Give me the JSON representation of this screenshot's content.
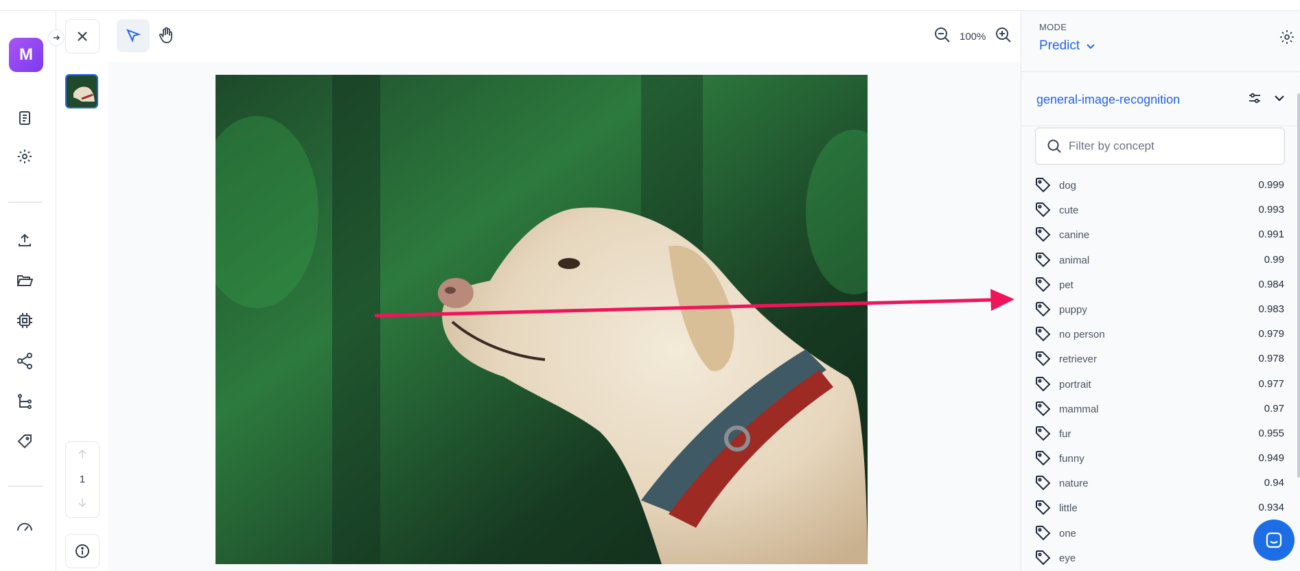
{
  "app": {
    "avatar_letter": "M",
    "accent": "#2563eb",
    "avatar_color": "#8b5cf6"
  },
  "toolbar": {
    "zoom": "100%"
  },
  "pager": {
    "page": "1"
  },
  "panel": {
    "mode_label": "MODE",
    "mode_value": "Predict",
    "model_name": "general-image-recognition",
    "filter_placeholder": "Filter by concept",
    "concepts": [
      {
        "name": "dog",
        "score": "0.999"
      },
      {
        "name": "cute",
        "score": "0.993"
      },
      {
        "name": "canine",
        "score": "0.991"
      },
      {
        "name": "animal",
        "score": "0.99"
      },
      {
        "name": "pet",
        "score": "0.984"
      },
      {
        "name": "puppy",
        "score": "0.983"
      },
      {
        "name": "no person",
        "score": "0.979"
      },
      {
        "name": "retriever",
        "score": "0.978"
      },
      {
        "name": "portrait",
        "score": "0.977"
      },
      {
        "name": "mammal",
        "score": "0.97"
      },
      {
        "name": "fur",
        "score": "0.955"
      },
      {
        "name": "funny",
        "score": "0.949"
      },
      {
        "name": "nature",
        "score": "0.94"
      },
      {
        "name": "little",
        "score": "0.934"
      },
      {
        "name": "one",
        "score": ""
      },
      {
        "name": "eye",
        "score": ""
      }
    ]
  },
  "annotation": {
    "arrow_color": "#f0145a"
  }
}
